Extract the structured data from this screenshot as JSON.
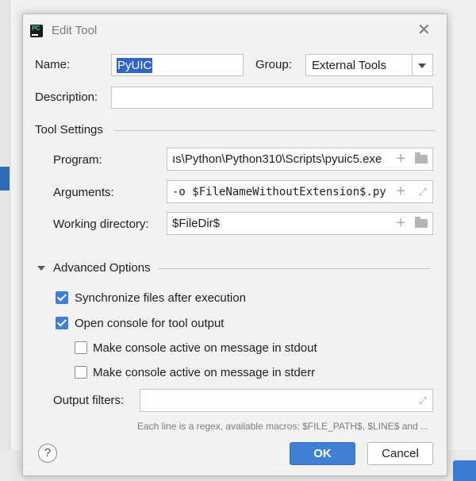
{
  "dialog": {
    "title": "Edit Tool",
    "icon_text": "PC",
    "close_glyph": "✕"
  },
  "name": {
    "label": "Name:",
    "value": "PyUIC"
  },
  "group": {
    "label": "Group:",
    "value": "External Tools"
  },
  "description": {
    "label": "Description:",
    "value": ""
  },
  "tool_settings": {
    "heading": "Tool Settings",
    "program": {
      "label": "Program:",
      "value": "ıs\\Python\\Python310\\Scripts\\pyuic5.exe"
    },
    "arguments": {
      "label": "Arguments:",
      "value": "-o $FileNameWithoutExtension$.py"
    },
    "working_directory": {
      "label": "Working directory:",
      "value": "$FileDir$"
    },
    "plus_glyph": "+",
    "expand_glyph": "⤢"
  },
  "advanced": {
    "heading": "Advanced Options",
    "options": [
      {
        "label": "Synchronize files after execution",
        "checked": true
      },
      {
        "label": "Open console for tool output",
        "checked": true
      },
      {
        "label": "Make console active on message in stdout",
        "checked": false
      },
      {
        "label": "Make console active on message in stderr",
        "checked": false
      }
    ],
    "output_filters": {
      "label": "Output filters:",
      "value": ""
    },
    "hint": "Each line is a regex, available macros: $FILE_PATH$, $LINE$ and ..."
  },
  "footer": {
    "help_glyph": "?",
    "ok_label": "OK",
    "cancel_label": "Cancel"
  },
  "colors": {
    "accent": "#3f80d6",
    "selection": "#2f65ca",
    "dialog_bg": "#f2f2f2"
  }
}
